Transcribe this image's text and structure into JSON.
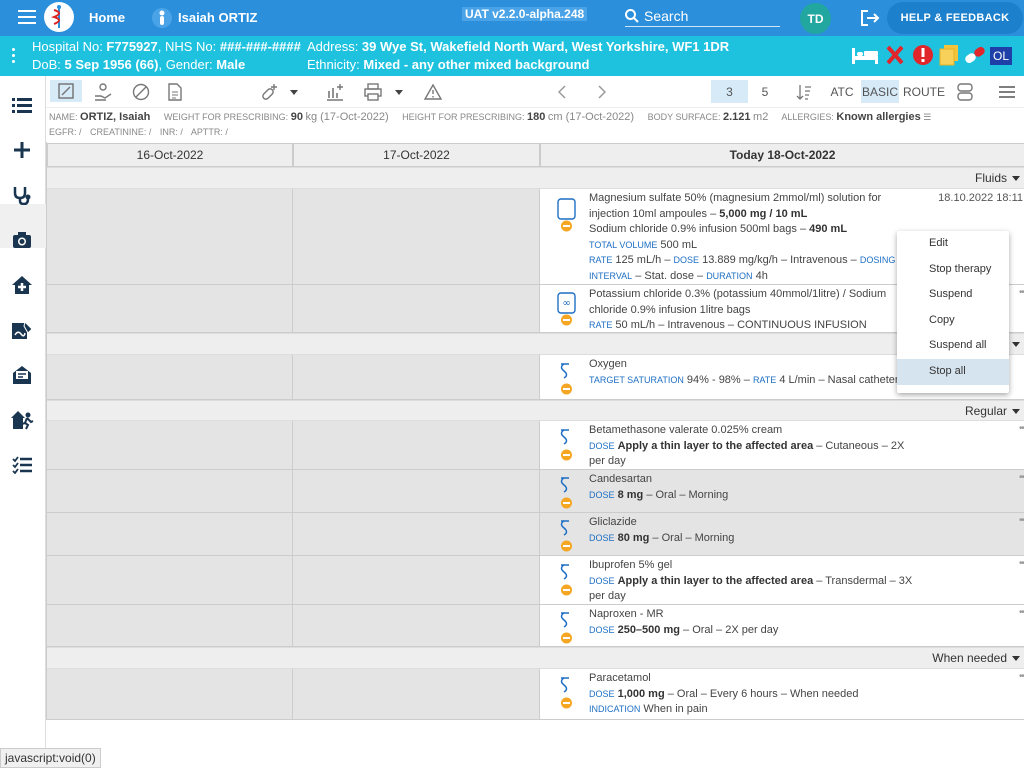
{
  "topbar": {
    "home": "Home",
    "patient_name": "Isaiah ORTIZ",
    "version": "UAT v2.2.0-alpha.248",
    "search": "Search",
    "avatar": "TD",
    "help": "HELP & FEEDBACK"
  },
  "patient_bar": {
    "hospital_label": "Hospital No: ",
    "hospital_no": "F775927",
    "nhs_label": ", NHS No: ",
    "nhs_no": "###-###-####",
    "address_label": "Address: ",
    "address": "39 Wye St, Wakefield North Ward, West Yorkshire, WF1 1DR",
    "dob_label": "DoB: ",
    "dob": "5 Sep 1956 (66)",
    "gender_label": ", Gender: ",
    "gender": "Male",
    "ethnicity_label": "Ethnicity: ",
    "ethnicity": "Mixed - any other mixed background",
    "ol_badge": "OL"
  },
  "toolbar": {
    "page3": "3",
    "page5": "5",
    "atc": "ATC",
    "basic": "BASIC",
    "route": "ROUTE"
  },
  "info": {
    "name_label": "NAME:",
    "name": "ORTIZ, Isaiah",
    "weight_label": "WEIGHT FOR PRESCRIBING:",
    "weight": "90",
    "weight_unit": "kg (17-Oct-2022)",
    "height_label": "HEIGHT FOR PRESCRIBING:",
    "height": "180",
    "height_unit": "cm (17-Oct-2022)",
    "bsa_label": "BODY SURFACE:",
    "bsa": "2.121",
    "bsa_unit": "m2",
    "allergy_label": "ALLERGIES:",
    "allergies": "Known allergies",
    "egfr": "EGFR: /",
    "creat": "CREATININE: /",
    "inr": "INR: /",
    "apttr": "APTTR: /"
  },
  "dates": [
    "16-Oct-2022",
    "17-Oct-2022",
    "Today 18-Oct-2022"
  ],
  "categories": {
    "fluids": "Fluids",
    "regular": "Regular",
    "when_needed": "When needed"
  },
  "meds": {
    "m1": {
      "l1": "Magnesium sulfate 50% (magnesium 2mmol/ml) solution for",
      "l2a": "injection 10ml ampoules – ",
      "l2b": "5,000 mg / 10 mL",
      "l3a": "Sodium chloride 0.9% infusion 500ml bags – ",
      "l3b": "490 mL",
      "tv_lbl": "TOTAL VOLUME",
      "tv": " 500 mL",
      "rate_lbl": "RATE",
      "rate": " 125 mL/h – ",
      "dose_lbl": "DOSE",
      "dose": " 13.889 mg/kg/h – Intravenous – ",
      "di_lbl": "DOSING",
      "int_lbl": "INTERVAL",
      "int": " – Stat. dose – ",
      "dur_lbl": "DURATION",
      "dur": " 4h",
      "time": "18.10.2022 18:11"
    },
    "m2": {
      "l1": "Potassium chloride 0.3% (potassium 40mmol/1litre) / Sodium",
      "l2": "chloride 0.9% infusion 1litre bags",
      "rate_lbl": "RATE",
      "rate": " 50 mL/h – Intravenous – CONTINUOUS INFUSION"
    },
    "m3": {
      "l1": "Oxygen",
      "ts_lbl": "TARGET SATURATION",
      "ts": " 94% - 98% – ",
      "rate_lbl": "RATE",
      "rate": " 4 L/min – Nasal catheter"
    },
    "m4": {
      "l1": "Betamethasone valerate 0.025% cream",
      "dose_lbl": "DOSE",
      "dose_b": "Apply a thin layer to the affected area",
      "dose_r": " – Cutaneous – 2X",
      "l3": "per day"
    },
    "m5": {
      "l1": "Candesartan",
      "dose_lbl": "DOSE",
      "dose_b": "8 mg",
      "dose_r": " – Oral – Morning"
    },
    "m6": {
      "l1": "Gliclazide",
      "dose_lbl": "DOSE",
      "dose_b": "80 mg",
      "dose_r": " – Oral – Morning"
    },
    "m7": {
      "l1": "Ibuprofen 5% gel",
      "dose_lbl": "DOSE",
      "dose_b": "Apply a thin layer to the affected area",
      "dose_r": " – Transdermal – 3X",
      "l3": "per day"
    },
    "m8": {
      "l1": "Naproxen - MR",
      "dose_lbl": "DOSE",
      "dose_b": "250–500 mg",
      "dose_r": " – Oral – 2X per day"
    },
    "m9": {
      "l1": "Paracetamol",
      "dose_lbl": "DOSE",
      "dose_b": "1,000 mg",
      "dose_r": " – Oral – Every 6 hours – When needed",
      "ind_lbl": "INDICATION",
      "ind": " When in pain"
    }
  },
  "context_menu": [
    "Edit",
    "Stop therapy",
    "Suspend",
    "Copy",
    "Suspend all",
    "Stop all"
  ],
  "status_bar": "javascript:void(0)",
  "colors": {
    "topbar": "#2b8fdc",
    "patient_bar": "#1ec2df",
    "accent": "#1e6fc4",
    "alert": "#e0262b"
  }
}
